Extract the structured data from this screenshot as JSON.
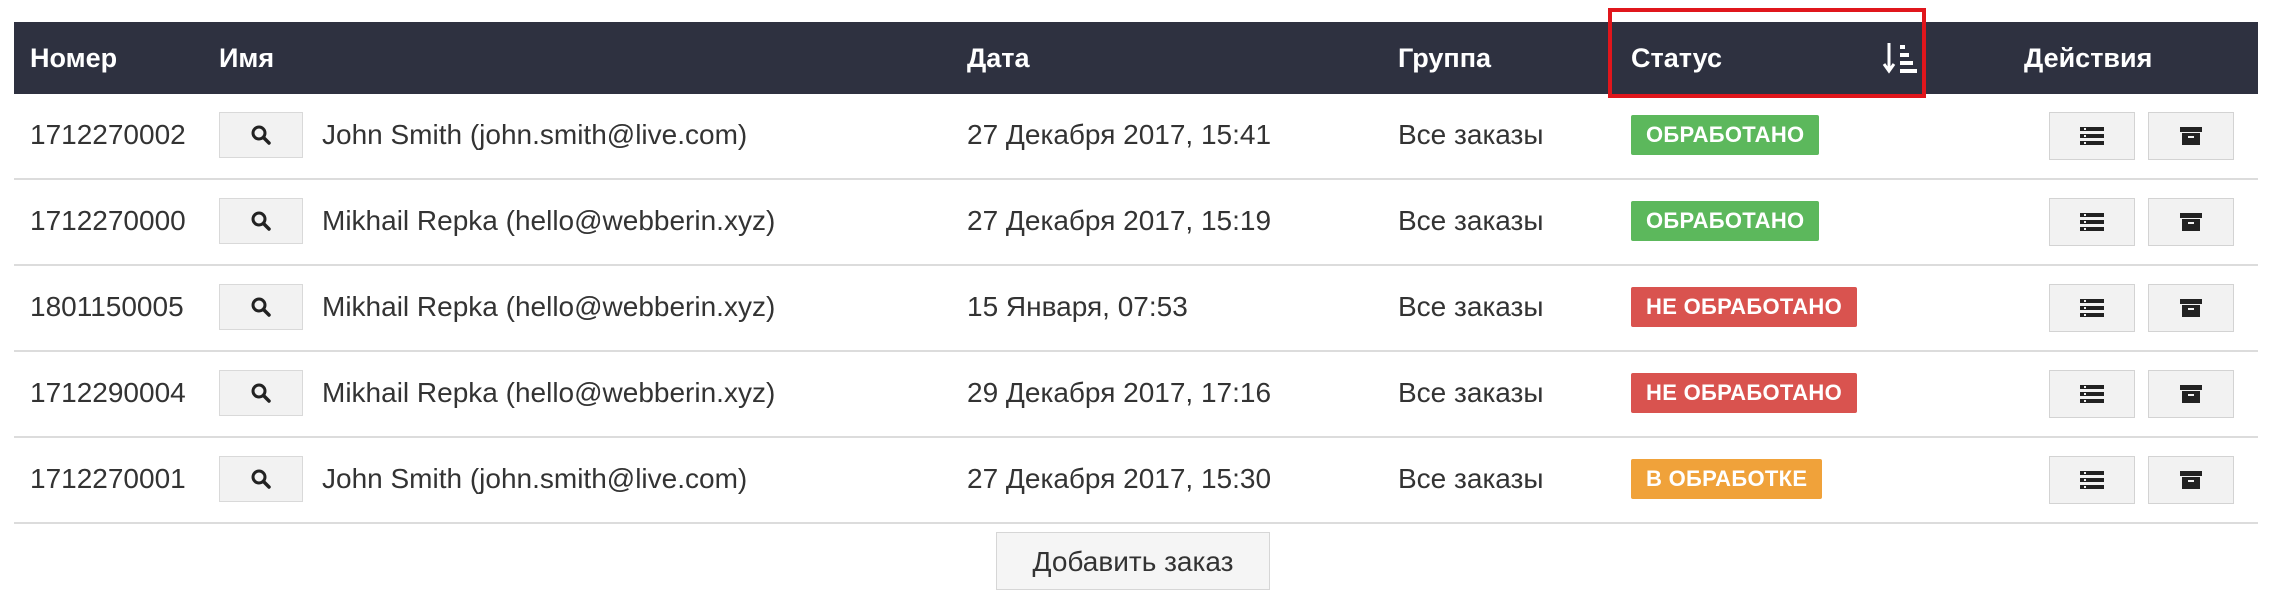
{
  "table": {
    "headers": {
      "number": "Номер",
      "name": "Имя",
      "date": "Дата",
      "group": "Группа",
      "status": "Статус",
      "actions": "Действия"
    },
    "sort_icon": "sort-descending-icon",
    "rows": [
      {
        "number": "1712270002",
        "name": "John Smith (john.smith@live.com)",
        "date": "27 Декабря 2017, 15:41",
        "group": "Все заказы",
        "status": "ОБРАБОТАНО",
        "status_color": "#5cb85c"
      },
      {
        "number": "1712270000",
        "name": "Mikhail Repka (hello@webberin.xyz)",
        "date": "27 Декабря 2017, 15:19",
        "group": "Все заказы",
        "status": "ОБРАБОТАНО",
        "status_color": "#5cb85c"
      },
      {
        "number": "1801150005",
        "name": "Mikhail Repka (hello@webberin.xyz)",
        "date": "15 Января, 07:53",
        "group": "Все заказы",
        "status": "НЕ ОБРАБОТАНО",
        "status_color": "#d9534f"
      },
      {
        "number": "1712290004",
        "name": "Mikhail Repka (hello@webberin.xyz)",
        "date": "29 Декабря 2017, 17:16",
        "group": "Все заказы",
        "status": "НЕ ОБРАБОТАНО",
        "status_color": "#d9534f"
      },
      {
        "number": "1712270001",
        "name": "John Smith (john.smith@live.com)",
        "date": "27 Декабря 2017, 15:30",
        "group": "Все заказы",
        "status": "В ОБРАБОТКЕ",
        "status_color": "#f0a23a"
      }
    ]
  },
  "add_order_label": "Добавить заказ",
  "colors": {
    "header_bg": "#2e3140",
    "highlight_border": "#e0161c",
    "processed": "#5cb85c",
    "not_processed": "#d9534f",
    "in_progress": "#f0a23a"
  }
}
